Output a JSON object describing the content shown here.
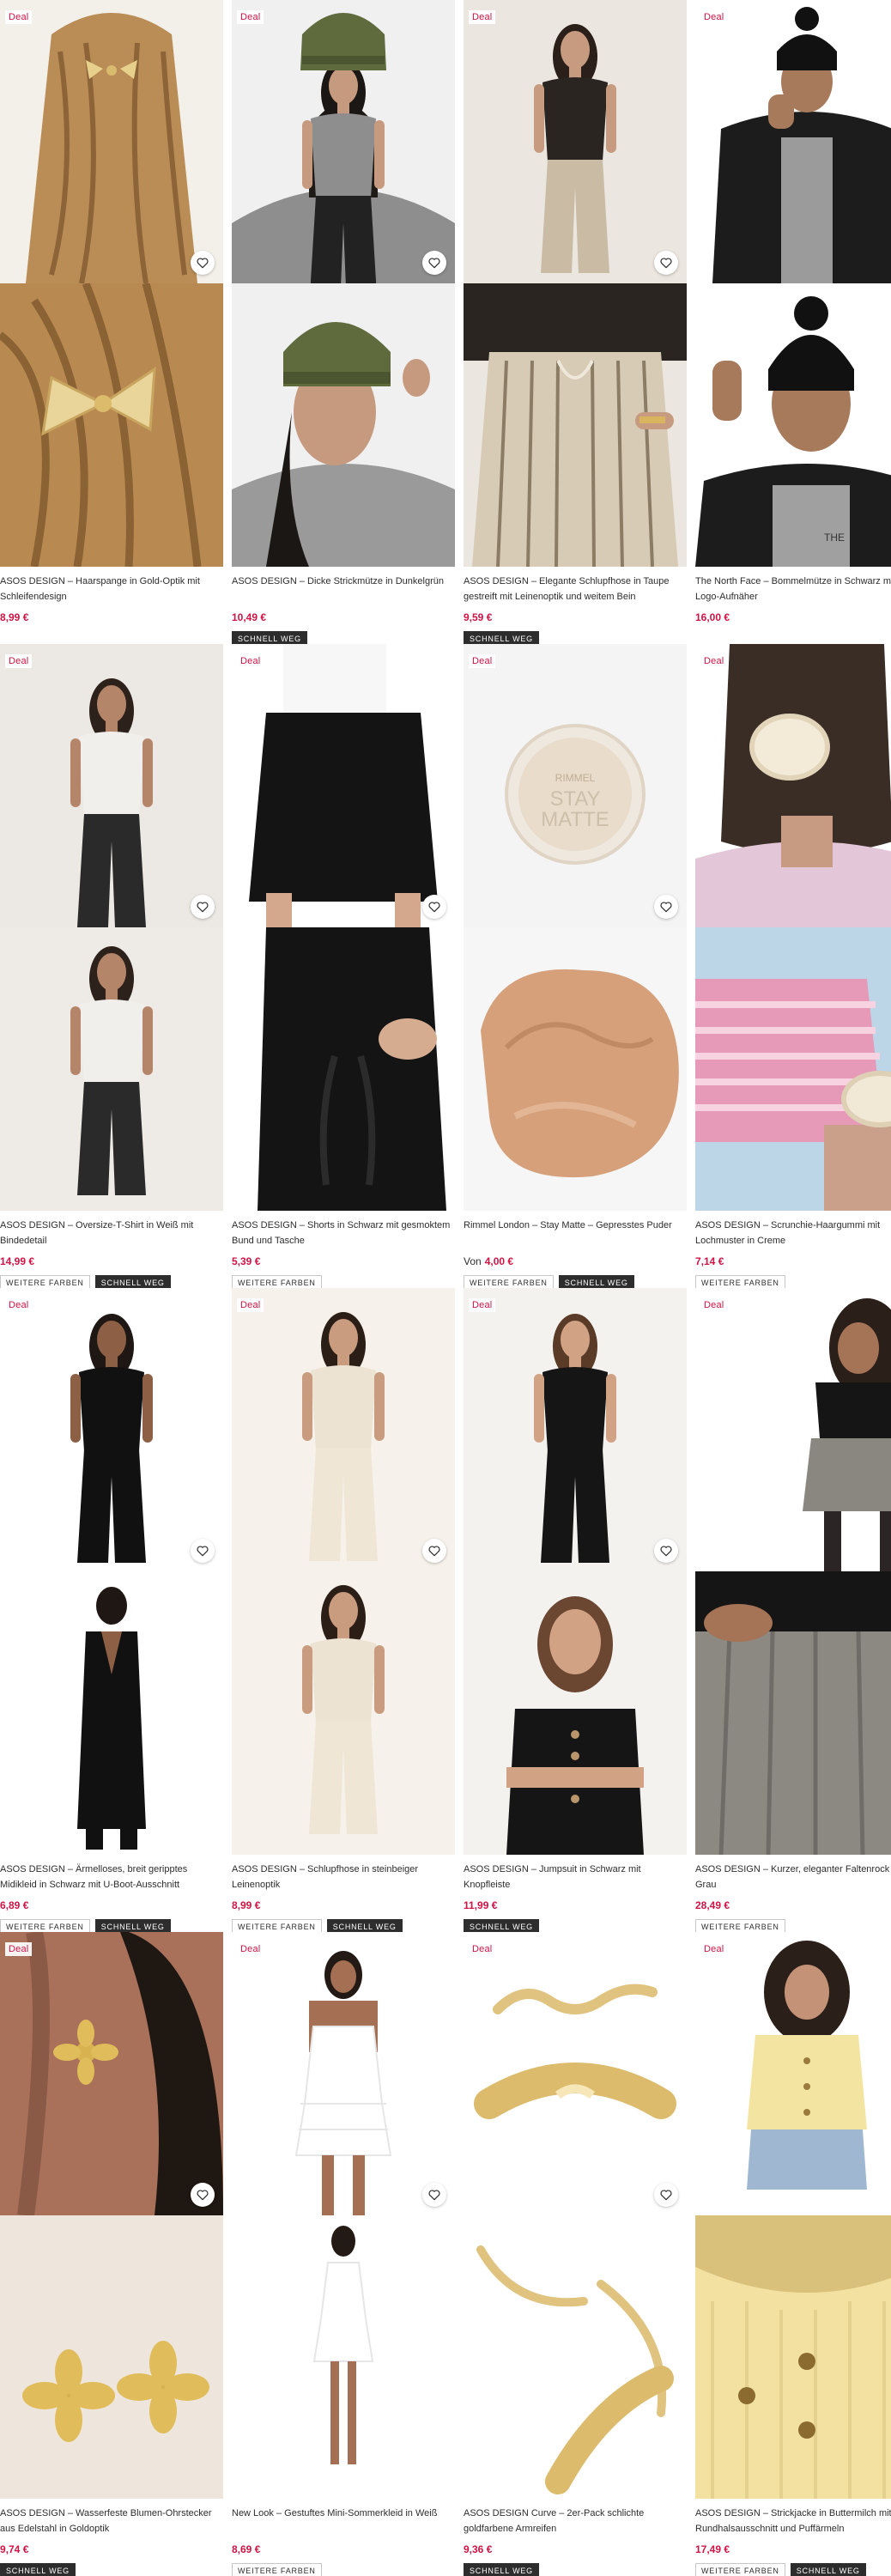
{
  "deal_label": "Deal",
  "badges": {
    "more_colors": "WEITERE FARBEN",
    "fast_delivery": "SCHNELL WEG"
  },
  "icons": {
    "favorite": "heart-outline-icon"
  },
  "colors": {
    "deal": "#d01345",
    "price": "#d01345",
    "text": "#2d2d2d",
    "badge_dark": "#2d2d2d"
  },
  "products": [
    {
      "title": "ASOS DESIGN – Haarspange in Gold-Optik mit Schleifendesign",
      "price": "8,99 €",
      "price_prefix": "",
      "more_colors": false,
      "fast": false
    },
    {
      "title": "ASOS DESIGN – Dicke Strickmütze in Dunkelgrün",
      "price": "10,49 €",
      "price_prefix": "",
      "more_colors": false,
      "fast": true
    },
    {
      "title": "ASOS DESIGN – Elegante Schlupfhose in Taupe gestreift mit Leinenoptik und weitem Bein",
      "price": "9,59 €",
      "price_prefix": "",
      "more_colors": false,
      "fast": true
    },
    {
      "title": "The North Face – Bommelmütze in Schwarz mit Logo-Aufnäher",
      "price": "16,00 €",
      "price_prefix": "",
      "more_colors": false,
      "fast": false
    },
    {
      "title": "ASOS DESIGN – Oversize-T-Shirt in Weiß mit Bindedetail",
      "price": "14,99 €",
      "price_prefix": "",
      "more_colors": true,
      "fast": true
    },
    {
      "title": "ASOS DESIGN – Shorts in Schwarz mit gesmoktem Bund und Tasche",
      "price": "5,39 €",
      "price_prefix": "",
      "more_colors": true,
      "fast": false
    },
    {
      "title": "Rimmel London – Stay Matte – Gepresstes Puder",
      "price": "4,00 €",
      "price_prefix": "Von",
      "more_colors": true,
      "fast": true
    },
    {
      "title": "ASOS DESIGN – Scrunchie-Haargummi mit Lochmuster in Creme",
      "price": "7,14 €",
      "price_prefix": "",
      "more_colors": true,
      "fast": false
    },
    {
      "title": "ASOS DESIGN – Ärmelloses, breit geripptes Midikleid in Schwarz mit U-Boot-Ausschnitt",
      "price": "6,89 €",
      "price_prefix": "",
      "more_colors": true,
      "fast": true
    },
    {
      "title": "ASOS DESIGN – Schlupfhose in steinbeiger Leinenoptik",
      "price": "8,99 €",
      "price_prefix": "",
      "more_colors": true,
      "fast": true
    },
    {
      "title": "ASOS DESIGN – Jumpsuit in Schwarz mit Knopfleiste",
      "price": "11,99 €",
      "price_prefix": "",
      "more_colors": false,
      "fast": true
    },
    {
      "title": "ASOS DESIGN – Kurzer, eleganter Faltenrock in Grau",
      "price": "28,49 €",
      "price_prefix": "",
      "more_colors": true,
      "fast": false
    },
    {
      "title": "ASOS DESIGN – Wasserfeste Blumen-Ohrstecker aus Edelstahl in Goldoptik",
      "price": "9,74 €",
      "price_prefix": "",
      "more_colors": false,
      "fast": true
    },
    {
      "title": "New Look – Gestuftes Mini-Sommerkleid in Weiß",
      "price": "8,69 €",
      "price_prefix": "",
      "more_colors": true,
      "fast": false
    },
    {
      "title": "ASOS DESIGN Curve – 2er-Pack schlichte goldfarbene Armreifen",
      "price": "9,36 €",
      "price_prefix": "",
      "more_colors": false,
      "fast": true
    },
    {
      "title": "ASOS DESIGN – Strickjacke in Buttermilch mit Rundhalsausschnitt und Puffärmeln",
      "price": "17,49 €",
      "price_prefix": "",
      "more_colors": true,
      "fast": true
    }
  ]
}
